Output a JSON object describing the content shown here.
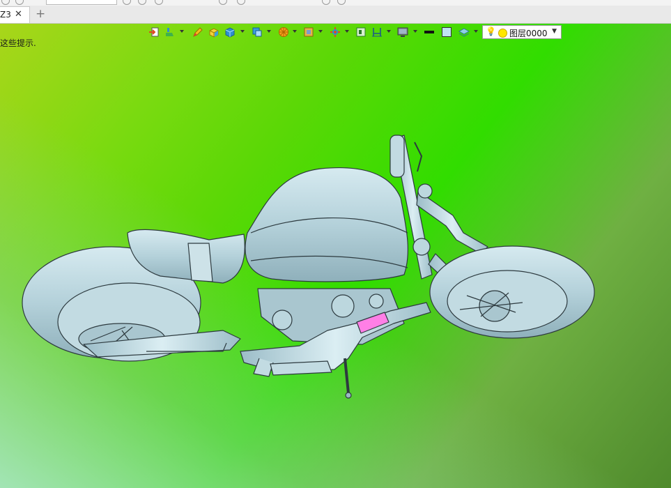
{
  "quick_access": {
    "combo_value": ""
  },
  "tab": {
    "label": "Z3",
    "close_glyph": "✕",
    "new_tab_glyph": "+"
  },
  "viewport": {
    "hint_text": "这些提示."
  },
  "toolbar": {
    "icons": [
      "import-icon",
      "paint-icon",
      "pencil-icon",
      "solid-box-icon",
      "cube-icon",
      "view-cube-icon",
      "section-icon",
      "display-icon",
      "origin-icon",
      "frame-icon",
      "dimension-icon",
      "monitor-icon",
      "line-color-icon",
      "fill-color-icon",
      "layer-icon"
    ],
    "layer": {
      "name": "图层0000",
      "bulb": "💡",
      "arrow": "▼"
    }
  },
  "colors": {
    "model_fill": "#b9d6de",
    "model_stroke": "#2d3a3f",
    "highlight": "#ff7fe6"
  }
}
